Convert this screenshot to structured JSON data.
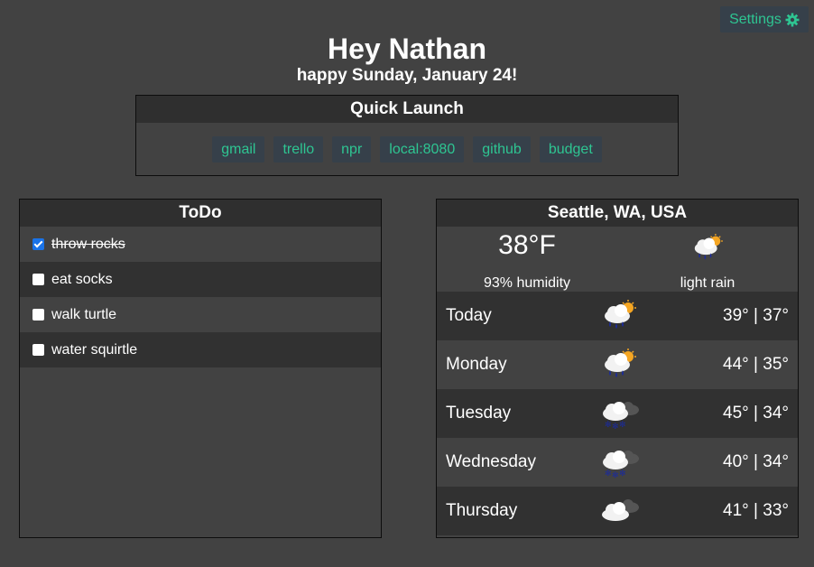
{
  "settings": {
    "label": "Settings",
    "icon": "gear-icon",
    "accent": "#2ec592"
  },
  "greeting": {
    "title": "Hey Nathan",
    "subtitle": "happy Sunday, January 24!"
  },
  "quick_launch": {
    "title": "Quick Launch",
    "links": [
      "gmail",
      "trello",
      "npr",
      "local:8080",
      "github",
      "budget"
    ]
  },
  "todo": {
    "title": "ToDo",
    "items": [
      {
        "text": "throw rocks",
        "done": true
      },
      {
        "text": "eat socks",
        "done": false
      },
      {
        "text": "walk turtle",
        "done": false
      },
      {
        "text": "water squirtle",
        "done": false
      }
    ]
  },
  "weather": {
    "location": "Seattle, WA, USA",
    "current": {
      "temp": "38°F",
      "humidity": "93% humidity",
      "condition": "light rain",
      "icon": "rain-sun-icon"
    },
    "forecast": [
      {
        "day": "Today",
        "temps": "39° | 37°",
        "icon": "rain-sun-icon"
      },
      {
        "day": "Monday",
        "temps": "44° | 35°",
        "icon": "rain-sun-icon"
      },
      {
        "day": "Tuesday",
        "temps": "45° | 34°",
        "icon": "snow-cloud-icon"
      },
      {
        "day": "Wednesday",
        "temps": "40° | 34°",
        "icon": "snow-cloud-icon"
      },
      {
        "day": "Thursday",
        "temps": "41° | 33°",
        "icon": "cloud-icon"
      }
    ]
  }
}
